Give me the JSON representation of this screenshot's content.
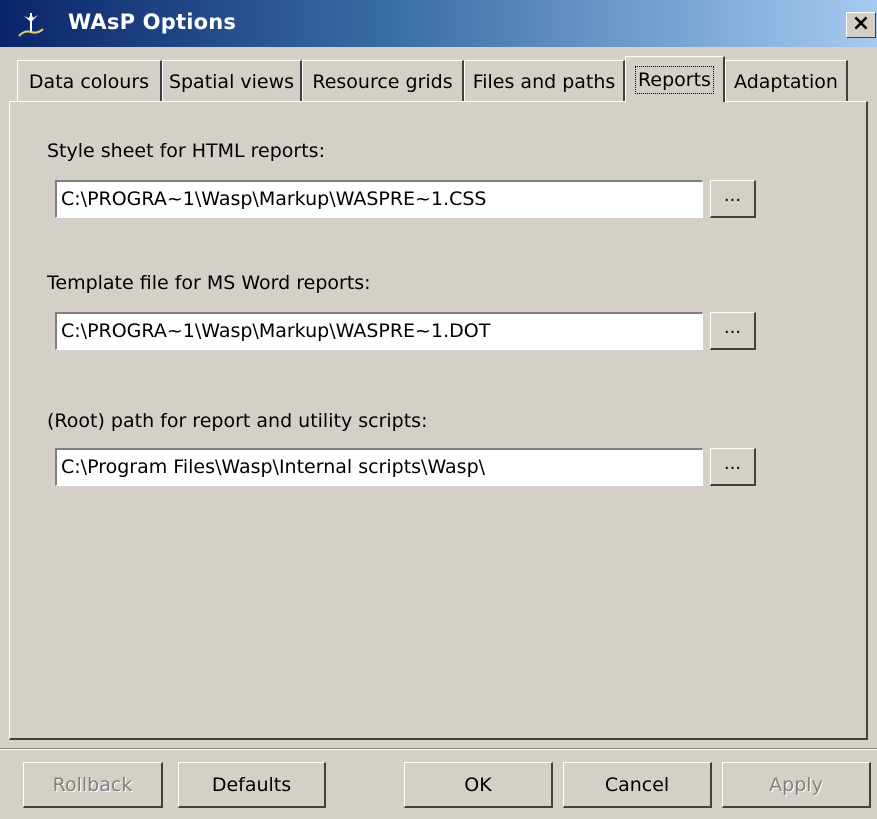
{
  "window": {
    "title": "WAsP Options",
    "close_label": "×"
  },
  "tabs": [
    {
      "label": "Data colours",
      "active": false
    },
    {
      "label": "Spatial views",
      "active": false
    },
    {
      "label": "Resource grids",
      "active": false
    },
    {
      "label": "Files and paths",
      "active": false
    },
    {
      "label": "Reports",
      "active": true
    },
    {
      "label": "Adaptation",
      "active": false
    }
  ],
  "reports": {
    "css": {
      "label": "Style sheet for HTML reports:",
      "value": "C:\\PROGRA~1\\Wasp\\Markup\\WASPRE~1.CSS",
      "browse_label": "..."
    },
    "dot": {
      "label": "Template file for MS Word reports:",
      "value": "C:\\PROGRA~1\\Wasp\\Markup\\WASPRE~1.DOT",
      "browse_label": "..."
    },
    "scripts": {
      "label": "(Root) path for report and utility scripts:",
      "value": "C:\\Program Files\\Wasp\\Internal scripts\\Wasp\\",
      "browse_label": "..."
    }
  },
  "buttons": {
    "rollback": "Rollback",
    "defaults": "Defaults",
    "ok": "OK",
    "cancel": "Cancel",
    "apply": "Apply"
  }
}
